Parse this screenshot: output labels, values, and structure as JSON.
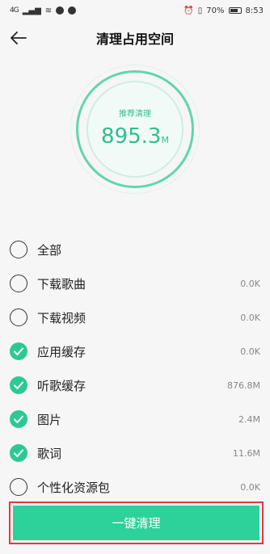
{
  "status": {
    "signal": "4G",
    "battery": "70%",
    "time": "8:53"
  },
  "header": {
    "title": "清理占用空间"
  },
  "summary": {
    "label": "推荐清理",
    "value": "895.3",
    "unit": "M"
  },
  "items": [
    {
      "label": "全部",
      "size": "",
      "checked": false
    },
    {
      "label": "下载歌曲",
      "size": "0.0K",
      "checked": false
    },
    {
      "label": "下载视频",
      "size": "0.0K",
      "checked": false
    },
    {
      "label": "应用缓存",
      "size": "0.0K",
      "checked": true
    },
    {
      "label": "听歌缓存",
      "size": "876.8M",
      "checked": true
    },
    {
      "label": "图片",
      "size": "2.4M",
      "checked": true
    },
    {
      "label": "歌词",
      "size": "11.6M",
      "checked": true
    },
    {
      "label": "个性化资源包",
      "size": "0.0K",
      "checked": false
    }
  ],
  "action": {
    "label": "一键清理"
  },
  "colors": {
    "accent": "#2dd29a",
    "highlight": "#e53935"
  }
}
